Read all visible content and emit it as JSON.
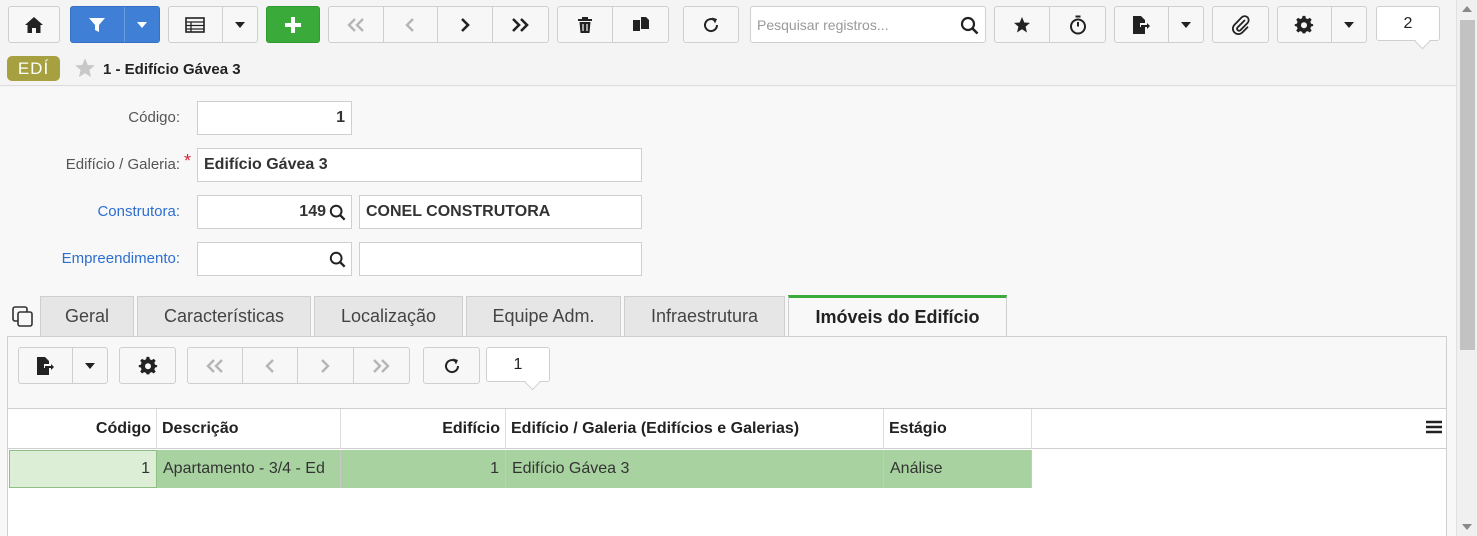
{
  "toolbar": {
    "search_placeholder": "Pesquisar registros...",
    "page_number": "2"
  },
  "header": {
    "badge": "EDÍ",
    "record_title": "1 - Edifício Gávea 3"
  },
  "form": {
    "codigo": {
      "label": "Código:",
      "value": "1"
    },
    "edificio": {
      "label": "Edifício / Galeria:",
      "required_mark": "*",
      "value": "Edifício Gávea 3"
    },
    "construtora": {
      "label": "Construtora:",
      "code": "149",
      "name": "CONEL CONSTRUTORA"
    },
    "empreendimento": {
      "label": "Empreendimento:",
      "code": "",
      "name": ""
    }
  },
  "tabs": [
    {
      "label": "Geral"
    },
    {
      "label": "Características"
    },
    {
      "label": "Localização"
    },
    {
      "label": "Equipe Adm."
    },
    {
      "label": "Infraestrutura"
    },
    {
      "label": "Imóveis do Edifício"
    }
  ],
  "subtoolbar": {
    "page_number": "1"
  },
  "grid": {
    "columns": [
      "Código",
      "Descrição",
      "Edifício",
      "Edifício / Galeria (Edifícios e Galerias)",
      "Estágio"
    ],
    "rows": [
      [
        "1",
        "Apartamento - 3/4 - Ed",
        "1",
        "Edifício Gávea 3",
        "Análise"
      ]
    ]
  },
  "colors": {
    "accent_blue": "#3f7fd6",
    "accent_green": "#3aab3a",
    "badge": "#a7a040",
    "row_selected": "#a8d3a0",
    "link": "#2d6fcf"
  }
}
